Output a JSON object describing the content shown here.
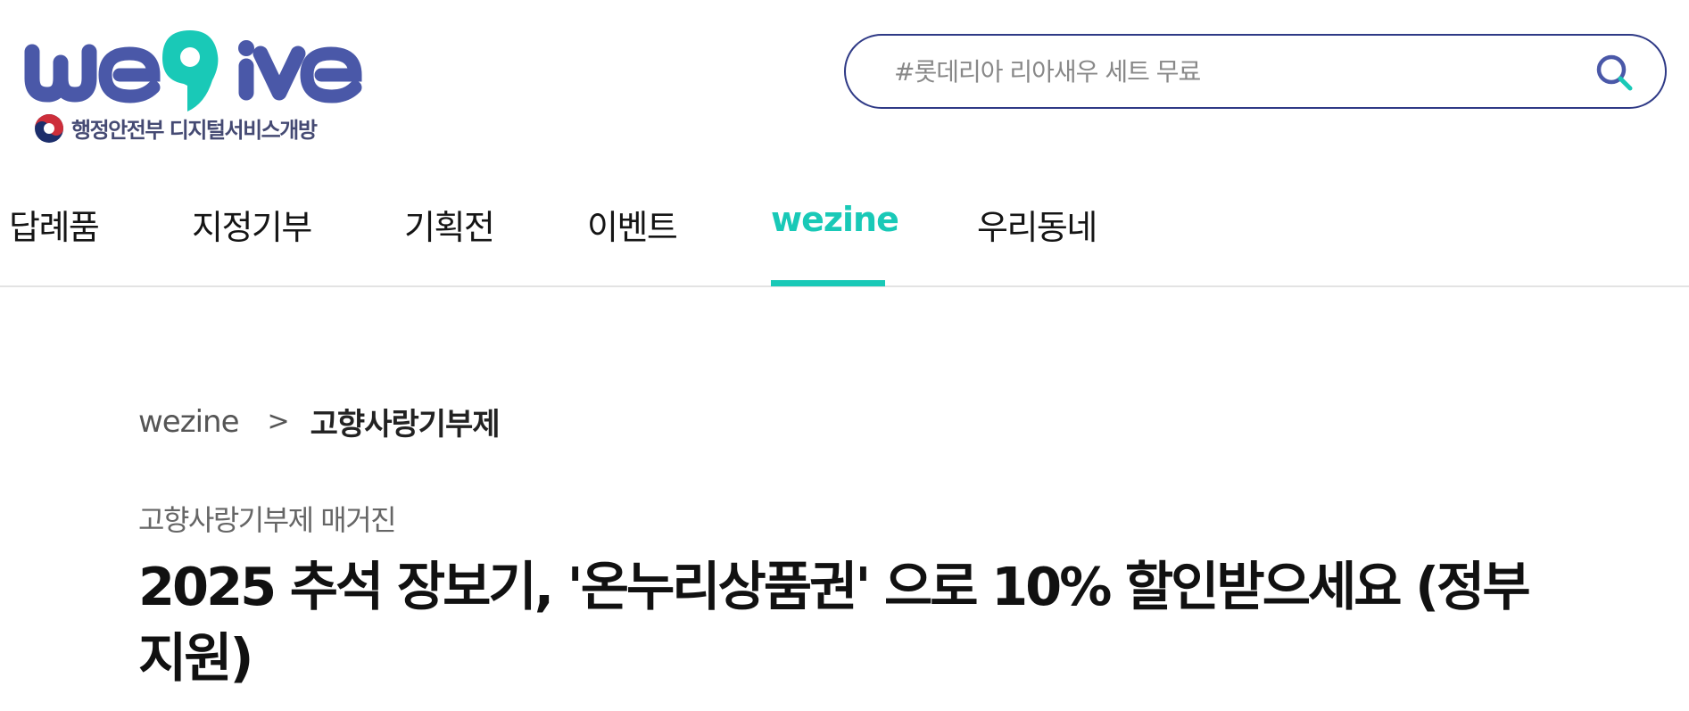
{
  "header": {
    "logo": {
      "text": "wegive",
      "subtitle": "행정안전부 디지털서비스개방",
      "colors": {
        "primary": "#4a58a8",
        "accent": "#19c9b7"
      }
    },
    "search": {
      "placeholder": "#롯데리아 리아새우 세트 무료",
      "value": "",
      "icon": "search-icon",
      "border_color": "#2f3a86"
    }
  },
  "nav": {
    "items": [
      {
        "label": "답례품",
        "active": false
      },
      {
        "label": "지정기부",
        "active": false
      },
      {
        "label": "기획전",
        "active": false
      },
      {
        "label": "이벤트",
        "active": false
      },
      {
        "label": "wezine",
        "active": true
      },
      {
        "label": "우리동네",
        "active": false
      }
    ],
    "active_color": "#19c9b7"
  },
  "breadcrumb": {
    "home": "wezine",
    "separator": ">",
    "current": "고향사랑기부제"
  },
  "article": {
    "category": "고향사랑기부제 매거진",
    "title": "2025 추석 장보기, '온누리상품권' 으로 10% 할인받으세요 (정부 지원)"
  }
}
